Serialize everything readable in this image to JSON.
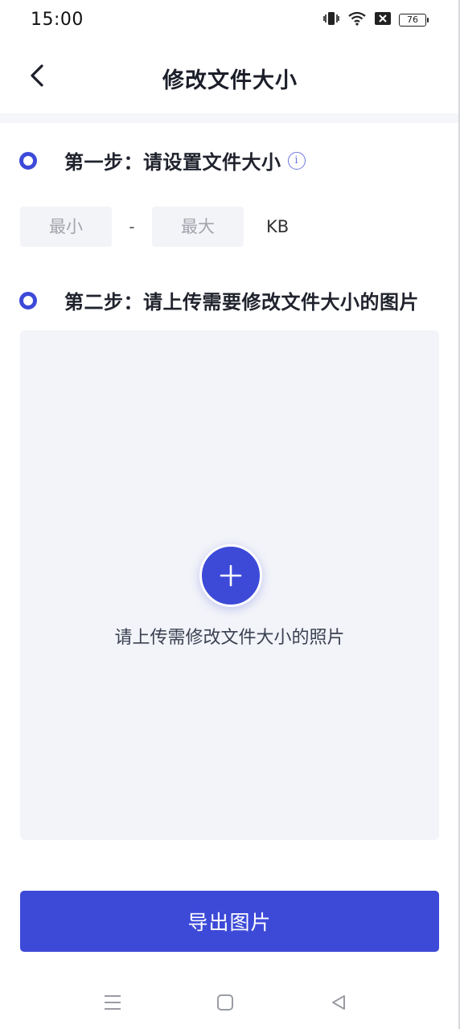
{
  "status_bar": {
    "time": "15:00",
    "battery": "76"
  },
  "header": {
    "title": "修改文件大小",
    "back_icon": "chevron-left-icon"
  },
  "step1": {
    "title": "第一步：请设置文件大小",
    "info_icon": "info-icon"
  },
  "size_range": {
    "min_placeholder": "最小",
    "separator": "-",
    "max_placeholder": "最大",
    "unit": "KB"
  },
  "step2": {
    "title": "第二步：请上传需要修改文件大小的图片"
  },
  "upload": {
    "icon": "plus-icon",
    "hint": "请上传需修改文件大小的照片"
  },
  "export_button": {
    "label": "导出图片"
  },
  "system_nav": {
    "items": [
      "menu-icon",
      "home-icon",
      "back-triangle-icon"
    ]
  },
  "colors": {
    "accent": "#3d4ad8",
    "upload_bg": "#f3f4f9",
    "input_bg": "#f3f4f7"
  }
}
